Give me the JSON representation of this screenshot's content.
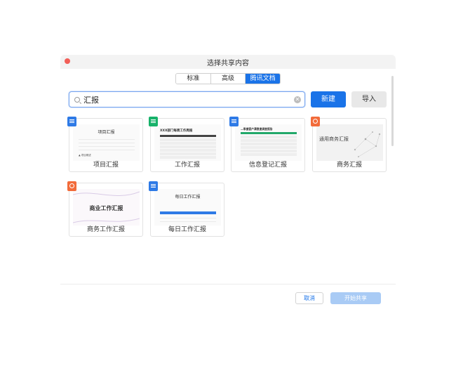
{
  "dialog": {
    "title": "选择共享内容"
  },
  "tabs": [
    {
      "label": "标准",
      "active": false
    },
    {
      "label": "高级",
      "active": false
    },
    {
      "label": "腾讯文档",
      "active": true
    }
  ],
  "search": {
    "value": "汇报"
  },
  "buttons": {
    "new_label": "新建",
    "import_label": "导入",
    "cancel_label": "取消",
    "start_label": "开始共享"
  },
  "colors": {
    "accent": "#1a73e8",
    "doc": "#2e7ae6",
    "sheet": "#17b26a",
    "ppt": "#f26b3a",
    "disabled": "#a9cbf5"
  },
  "templates": [
    {
      "label": "项目汇报",
      "type": "doc",
      "thumb_title": "项目汇报",
      "thumb_footer": "▲ 项目概述"
    },
    {
      "label": "工作汇报",
      "type": "sheet",
      "thumb_title": "XXX部门每周工作周报"
    },
    {
      "label": "信息登记汇报",
      "type": "doc",
      "thumb_title": "—季度客户满意度调查报告"
    },
    {
      "label": "商务汇报",
      "type": "ppt",
      "thumb_title": "通用商务汇报"
    },
    {
      "label": "商务工作汇报",
      "type": "ppt",
      "thumb_title": "商业工作汇报"
    },
    {
      "label": "每日工作汇报",
      "type": "doc",
      "thumb_title": "每日工作汇报"
    }
  ]
}
